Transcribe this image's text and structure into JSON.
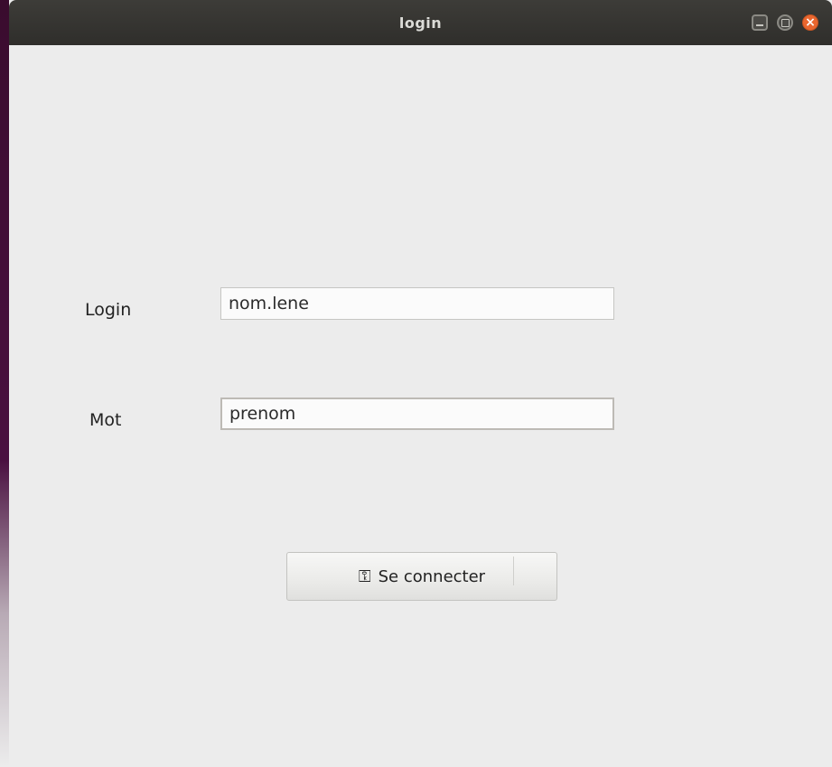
{
  "window": {
    "title": "login"
  },
  "titlebar": {
    "minimize_icon": "minimize-icon",
    "maximize_icon": "maximize-icon",
    "close_icon": "close-icon",
    "close_color": "#e9662f"
  },
  "form": {
    "login_label": "Login",
    "login_value": "nom.lene",
    "password_label": "Mot",
    "password_value": "prenom",
    "connect_label": "Se connecter",
    "connect_icon": "key-icon"
  }
}
